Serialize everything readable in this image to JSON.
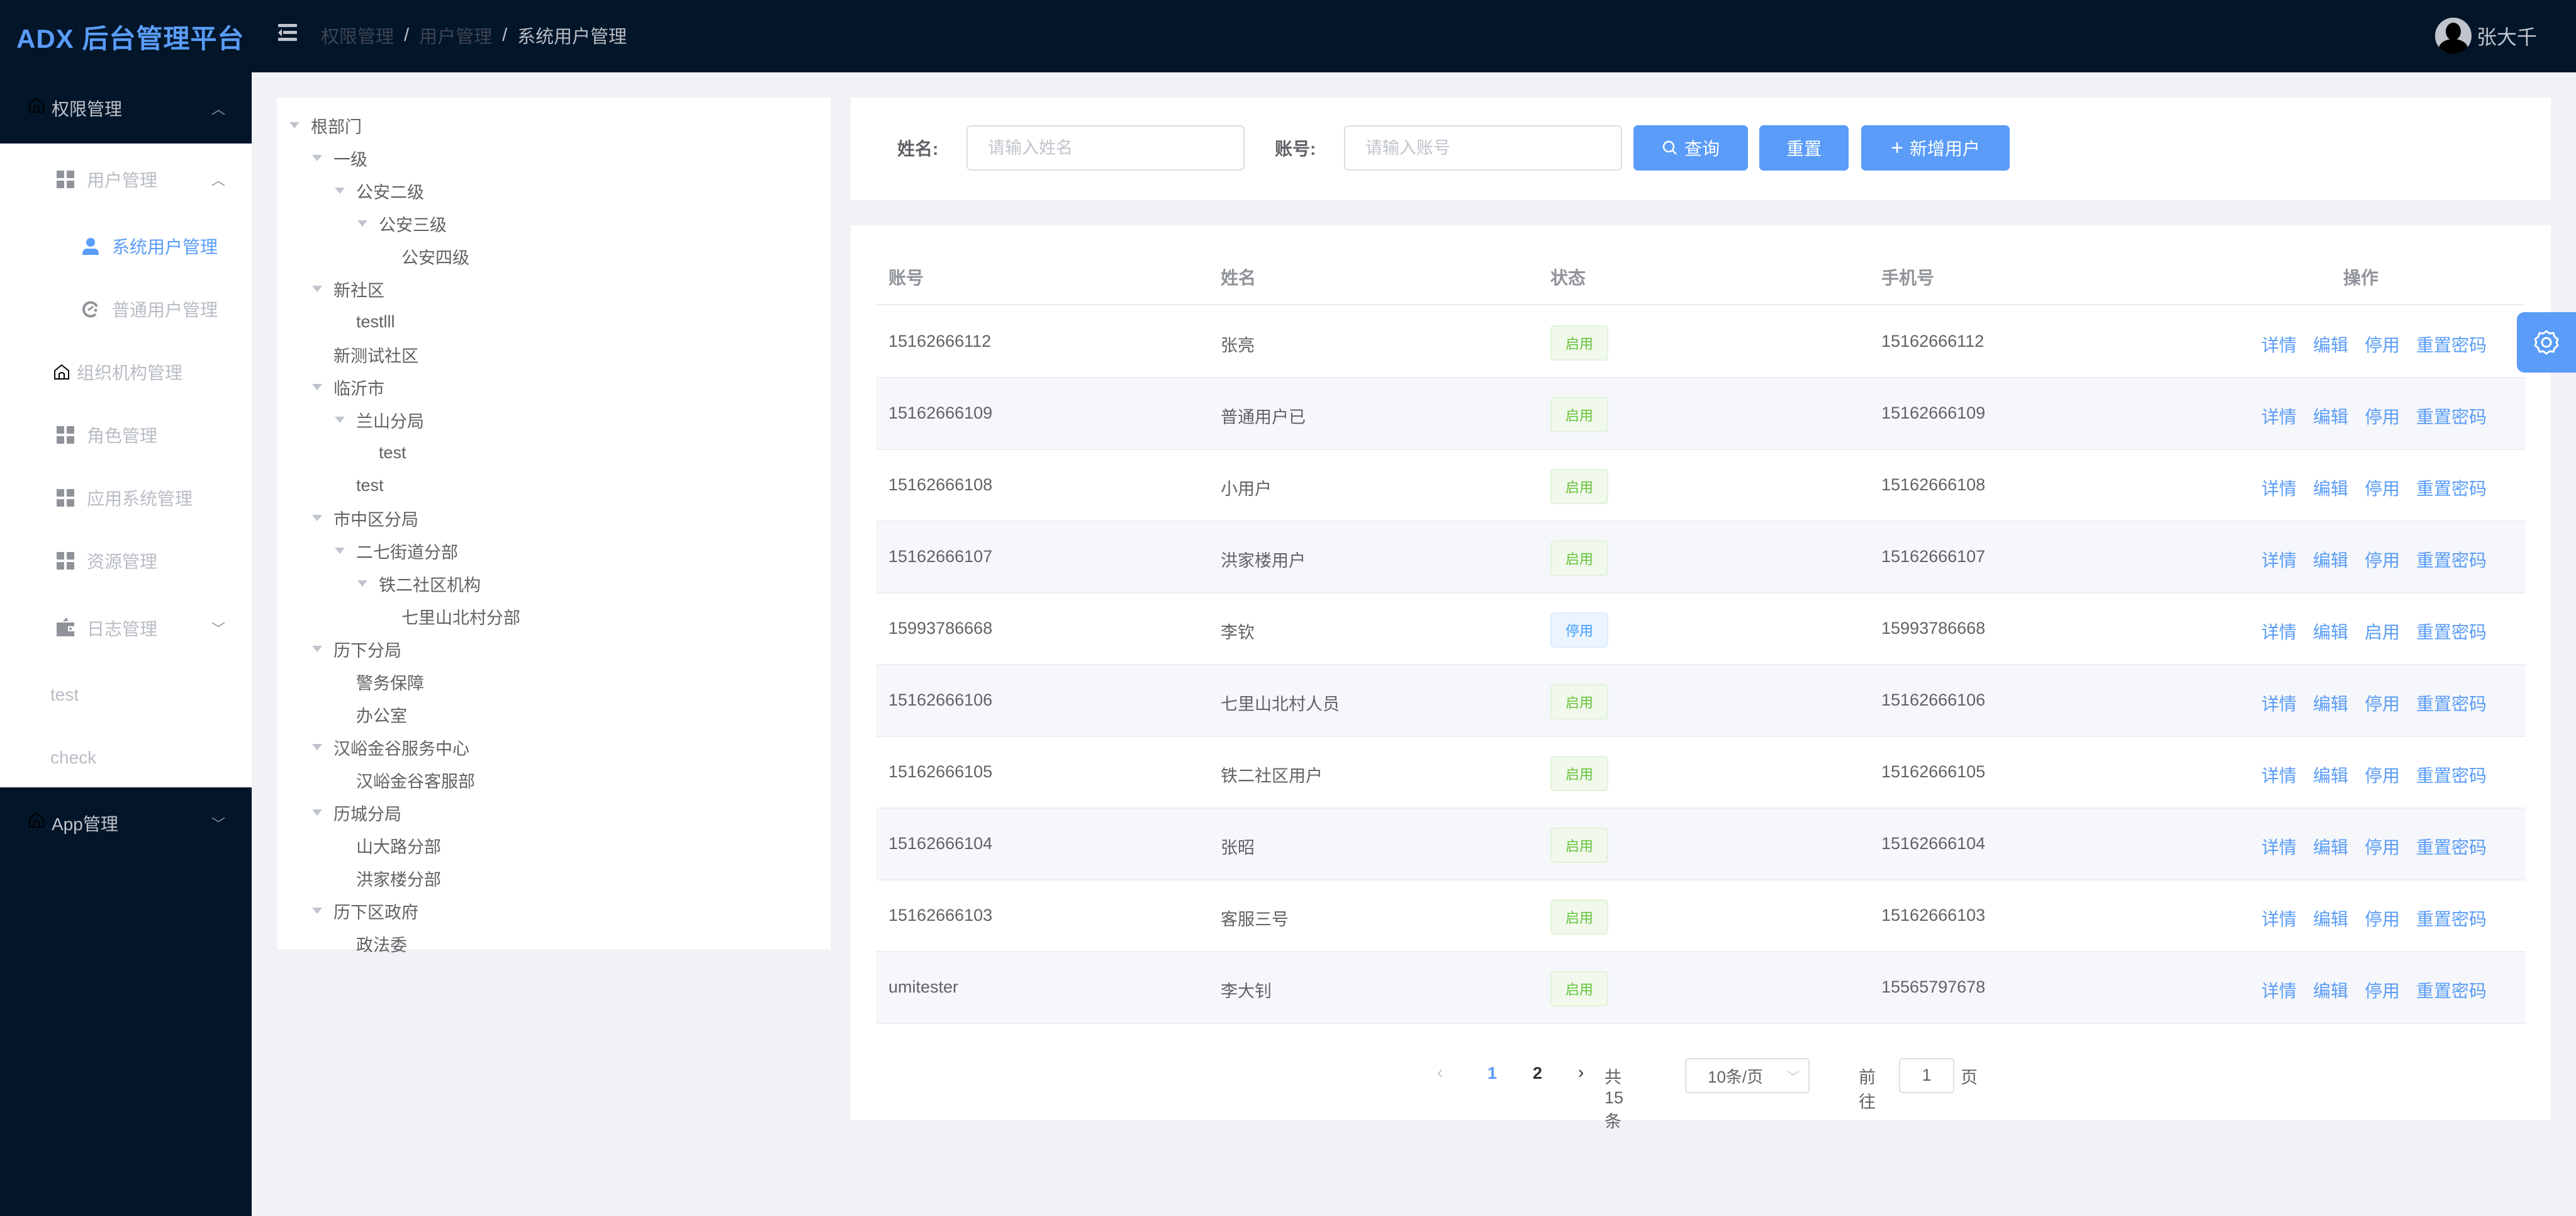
{
  "app": {
    "title": "ADX 后台管理平台"
  },
  "header": {
    "breadcrumb": [
      "权限管理",
      "用户管理",
      "系统用户管理"
    ],
    "separator": "/",
    "user_name": "张大千"
  },
  "sidebar": {
    "groups": [
      {
        "label": "权限管理",
        "icon": "home-icon",
        "expanded": true
      },
      {
        "label": "App管理",
        "icon": "home-icon",
        "expanded": false
      }
    ],
    "items": [
      {
        "label": "用户管理",
        "icon": "grid-icon",
        "expanded": true
      },
      {
        "label": "系统用户管理",
        "icon": "user-icon",
        "active": true
      },
      {
        "label": "普通用户管理",
        "icon": "refresh-icon"
      },
      {
        "label": "组织机构管理",
        "icon": "home-icon"
      },
      {
        "label": "角色管理",
        "icon": "grid-icon"
      },
      {
        "label": "应用系统管理",
        "icon": "grid-icon"
      },
      {
        "label": "资源管理",
        "icon": "grid-icon"
      },
      {
        "label": "日志管理",
        "icon": "wallet-icon",
        "expanded": false
      },
      {
        "label": "test"
      },
      {
        "label": "check"
      }
    ]
  },
  "tree": {
    "nodes": [
      {
        "label": "根部门",
        "level": 0,
        "expandable": true
      },
      {
        "label": "一级",
        "level": 1,
        "expandable": true
      },
      {
        "label": "公安二级",
        "level": 2,
        "expandable": true
      },
      {
        "label": "公安三级",
        "level": 3,
        "expandable": true
      },
      {
        "label": "公安四级",
        "level": 4,
        "expandable": false
      },
      {
        "label": "新社区",
        "level": 1,
        "expandable": true
      },
      {
        "label": "testlll",
        "level": 2,
        "expandable": false
      },
      {
        "label": "新测试社区",
        "level": 1,
        "expandable": false
      },
      {
        "label": "临沂市",
        "level": 1,
        "expandable": true
      },
      {
        "label": "兰山分局",
        "level": 2,
        "expandable": true
      },
      {
        "label": "test",
        "level": 3,
        "expandable": false
      },
      {
        "label": "test",
        "level": 2,
        "expandable": false
      },
      {
        "label": "市中区分局",
        "level": 1,
        "expandable": true
      },
      {
        "label": "二七街道分部",
        "level": 2,
        "expandable": true
      },
      {
        "label": "铁二社区机构",
        "level": 3,
        "expandable": true
      },
      {
        "label": "七里山北村分部",
        "level": 4,
        "expandable": false
      },
      {
        "label": "历下分局",
        "level": 1,
        "expandable": true
      },
      {
        "label": "警务保障",
        "level": 2,
        "expandable": false
      },
      {
        "label": "办公室",
        "level": 2,
        "expandable": false
      },
      {
        "label": "汉峪金谷服务中心",
        "level": 1,
        "expandable": true
      },
      {
        "label": "汉峪金谷客服部",
        "level": 2,
        "expandable": false
      },
      {
        "label": "历城分局",
        "level": 1,
        "expandable": true
      },
      {
        "label": "山大路分部",
        "level": 2,
        "expandable": false
      },
      {
        "label": "洪家楼分部",
        "level": 2,
        "expandable": false
      },
      {
        "label": "历下区政府",
        "level": 1,
        "expandable": true
      },
      {
        "label": "政法委",
        "level": 2,
        "expandable": false
      }
    ]
  },
  "search": {
    "name_label": "姓名:",
    "name_placeholder": "请输入姓名",
    "name_value": "",
    "account_label": "账号:",
    "account_placeholder": "请输入账号",
    "account_value": "",
    "query_label": "查询",
    "reset_label": "重置",
    "add_label": "新增用户"
  },
  "table": {
    "columns": [
      "账号",
      "姓名",
      "状态",
      "手机号",
      "操作"
    ],
    "rows": [
      {
        "account": "15162666112",
        "name": "张亮",
        "status": "启用",
        "status_type": "on",
        "phone": "15162666112",
        "actions": [
          "详情",
          "编辑",
          "停用",
          "重置密码"
        ]
      },
      {
        "account": "15162666109",
        "name": "普通用户已",
        "status": "启用",
        "status_type": "on",
        "phone": "15162666109",
        "actions": [
          "详情",
          "编辑",
          "停用",
          "重置密码"
        ]
      },
      {
        "account": "15162666108",
        "name": "小用户",
        "status": "启用",
        "status_type": "on",
        "phone": "15162666108",
        "actions": [
          "详情",
          "编辑",
          "停用",
          "重置密码"
        ]
      },
      {
        "account": "15162666107",
        "name": "洪家楼用户",
        "status": "启用",
        "status_type": "on",
        "phone": "15162666107",
        "actions": [
          "详情",
          "编辑",
          "停用",
          "重置密码"
        ]
      },
      {
        "account": "15993786668",
        "name": "李钦",
        "status": "停用",
        "status_type": "off",
        "phone": "15993786668",
        "actions": [
          "详情",
          "编辑",
          "启用",
          "重置密码"
        ]
      },
      {
        "account": "15162666106",
        "name": "七里山北村人员",
        "status": "启用",
        "status_type": "on",
        "phone": "15162666106",
        "actions": [
          "详情",
          "编辑",
          "停用",
          "重置密码"
        ]
      },
      {
        "account": "15162666105",
        "name": "铁二社区用户",
        "status": "启用",
        "status_type": "on",
        "phone": "15162666105",
        "actions": [
          "详情",
          "编辑",
          "停用",
          "重置密码"
        ]
      },
      {
        "account": "15162666104",
        "name": "张昭",
        "status": "启用",
        "status_type": "on",
        "phone": "15162666104",
        "actions": [
          "详情",
          "编辑",
          "停用",
          "重置密码"
        ]
      },
      {
        "account": "15162666103",
        "name": "客服三号",
        "status": "启用",
        "status_type": "on",
        "phone": "15162666103",
        "actions": [
          "详情",
          "编辑",
          "停用",
          "重置密码"
        ]
      },
      {
        "account": "umitester",
        "name": "李大钊",
        "status": "启用",
        "status_type": "on",
        "phone": "15565797678",
        "actions": [
          "详情",
          "编辑",
          "停用",
          "重置密码"
        ]
      }
    ]
  },
  "pagination": {
    "prev_icon": "‹",
    "next_icon": "›",
    "pages": [
      "1",
      "2"
    ],
    "current_page": "1",
    "total_text": "共 15 条",
    "page_size": "10条/页",
    "goto_label": "前往",
    "goto_value": "1",
    "page_suffix": "页"
  },
  "colors": {
    "primary": "#5a9cf8",
    "header_bg": "#021529",
    "success": "#67c23a",
    "info": "#409eff"
  }
}
